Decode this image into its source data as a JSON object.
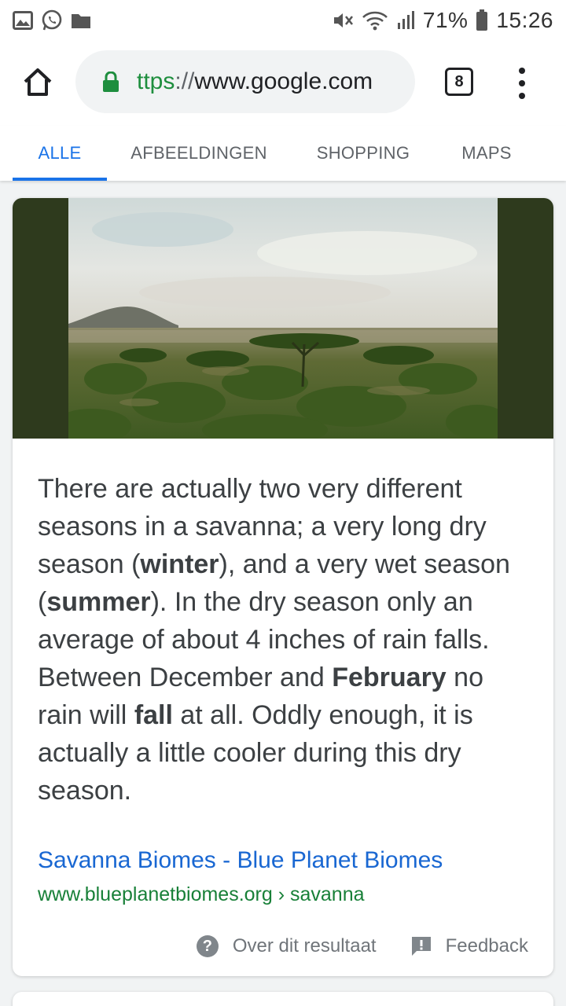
{
  "status_bar": {
    "icons_left": [
      "gallery-icon",
      "whatsapp-icon",
      "folder-icon"
    ],
    "icons_right": [
      "mute-icon",
      "wifi-icon",
      "signal-icon",
      "battery-icon"
    ],
    "battery": "71%",
    "time": "15:26"
  },
  "browser": {
    "url_scheme": "ttps",
    "url_separator": "://",
    "url_host": "www.google.com",
    "tab_count": "8"
  },
  "search_tabs": [
    {
      "label": "ALLE",
      "active": true
    },
    {
      "label": "AFBEELDINGEN",
      "active": false
    },
    {
      "label": "SHOPPING",
      "active": false
    },
    {
      "label": "MAPS",
      "active": false
    }
  ],
  "result": {
    "snippet": [
      {
        "text": "There are actually two very different seasons in a savanna; a very long dry season (",
        "bold": false
      },
      {
        "text": "winter",
        "bold": true
      },
      {
        "text": "), and a very wet season (",
        "bold": false
      },
      {
        "text": "summer",
        "bold": true
      },
      {
        "text": "). In the dry season only an average of about 4 inches of rain falls. Between December and ",
        "bold": false
      },
      {
        "text": "February",
        "bold": true
      },
      {
        "text": " no rain will ",
        "bold": false
      },
      {
        "text": "fall",
        "bold": true
      },
      {
        "text": " at all. Oddly enough, it is actually a little cooler during this dry season.",
        "bold": false
      }
    ],
    "title": "Savanna Biomes - Blue Planet Biomes",
    "url": "www.blueplanetbiomes.org › savanna",
    "about_label": "Over dit resultaat",
    "feedback_label": "Feedback"
  },
  "colors": {
    "accent": "#1a73e8",
    "link": "#1967d2",
    "url_green": "#188038",
    "lock_green": "#1e8e3e"
  }
}
